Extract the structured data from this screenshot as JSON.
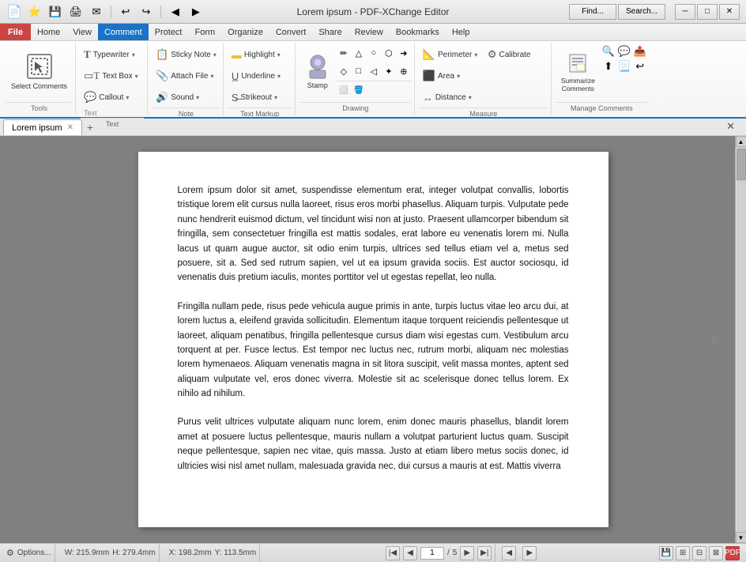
{
  "titlebar": {
    "title": "Lorem ipsum - PDF-XChange Editor",
    "min_label": "─",
    "max_label": "□",
    "close_label": "✕"
  },
  "quickaccess": {
    "icons": [
      "⭐",
      "💾",
      "🖨",
      "✉",
      "↩",
      "↪",
      "◀",
      "▶"
    ]
  },
  "menubar": {
    "items": [
      "File",
      "Home",
      "View",
      "Comment",
      "Protect",
      "Form",
      "Organize",
      "Convert",
      "Share",
      "Review",
      "Bookmarks",
      "Help"
    ]
  },
  "ribbon": {
    "groups": [
      {
        "label": "Tools",
        "buttons_large": [
          {
            "icon": "↖",
            "label": "Select\nComments"
          }
        ]
      },
      {
        "label": "Text",
        "columns": [
          [
            {
              "icon": "T",
              "label": "Typewriter",
              "dropdown": true
            },
            {
              "icon": "🗒",
              "label": "Text Box",
              "dropdown": true
            },
            {
              "icon": "↗",
              "label": "Callout",
              "dropdown": true
            }
          ]
        ]
      },
      {
        "label": "Note",
        "columns": [
          [
            {
              "icon": "📌",
              "label": "Sticky Note",
              "dropdown": true
            },
            {
              "icon": "📎",
              "label": "Attach File",
              "dropdown": true
            },
            {
              "icon": "🔊",
              "label": "Sound",
              "dropdown": true
            }
          ]
        ]
      },
      {
        "label": "Text Markup",
        "columns": [
          [
            {
              "icon": "H",
              "label": "Highlight",
              "dropdown": true
            },
            {
              "icon": "U",
              "label": "Underline",
              "dropdown": true
            },
            {
              "icon": "S",
              "label": "Strikeout",
              "dropdown": true
            }
          ]
        ]
      },
      {
        "label": "Drawing",
        "stamp_icon": "👤",
        "stamp_label": "Stamp",
        "shapes": [
          "✏",
          "△",
          "○",
          "⬡",
          "➜",
          "◇",
          "□",
          "◁",
          "✦",
          "⊕"
        ]
      },
      {
        "label": "Measure",
        "columns": [
          [
            {
              "icon": "📐",
              "label": "Perimeter",
              "dropdown": true
            },
            {
              "icon": "⬛",
              "label": "Area",
              "dropdown": true
            },
            {
              "icon": "↔",
              "label": "Distance",
              "dropdown": true
            },
            {
              "icon": "⚙",
              "label": "Calibrate"
            }
          ]
        ]
      },
      {
        "label": "Manage Comments",
        "columns": [
          [
            {
              "icon": "📋",
              "label": "Summarize\nComments"
            }
          ],
          [
            {
              "icon": "🔍"
            },
            {
              "icon": "💬"
            },
            {
              "icon": "📤"
            }
          ],
          [
            {
              "icon": "⬆"
            },
            {
              "icon": "📃"
            },
            {
              "icon": "↩"
            }
          ]
        ]
      }
    ],
    "find_label": "Find...",
    "search_label": "Search..."
  },
  "tabs": {
    "items": [
      {
        "label": "Lorem ipsum",
        "active": true
      }
    ],
    "add_label": "+"
  },
  "document": {
    "paragraphs": [
      "Lorem ipsum dolor sit amet, suspendisse elementum erat, integer volutpat convallis, lobortis tristique lorem elit cursus nulla laoreet, risus eros morbi phasellus. Aliquam turpis. Vulputate pede nunc hendrerit euismod dictum, vel tincidunt wisi non at justo. Praesent ullamcorper bibendum sit fringilla, sem consectetuer fringilla est mattis sodales, erat labore eu venenatis lorem mi. Nulla lacus ut quam augue auctor, sit odio enim turpis, ultrices sed tellus etiam vel a, metus sed posuere, sit a. Sed sed rutrum sapien, vel ut ea ipsum gravida sociis. Est auctor sociosqu, id venenatis duis pretium iaculis, montes porttitor vel ut egestas repellat, leo nulla.",
      "Fringilla nullam pede, risus pede vehicula augue primis in ante, turpis luctus vitae leo arcu dui, at lorem luctus a, eleifend gravida sollicitudin. Elementum itaque torquent reiciendis pellentesque ut laoreet, aliquam penatibus, fringilla pellentesque cursus diam wisi egestas cum. Vestibulum arcu torquent at per. Fusce lectus. Est tempor nec luctus nec, rutrum morbi, aliquam nec molestias lorem hymenaeos. Aliquam venenatis magna in sit litora suscipit, velit massa montes, aptent sed aliquam vulputate vel, eros donec viverra. Molestie sit ac scelerisque donec tellus lorem. Ex nihilo ad nihilum.",
      "Purus velit ultrices vulputate aliquam nunc lorem, enim donec mauris phasellus, blandit lorem amet at posuere luctus pellentesque, mauris nullam a volutpat parturient luctus quam. Suscipit neque pellentesque, sapien nec vitae, quis massa. Justo at etiam libero metus sociis donec, id ultricies wisi nisl amet nullam, malesuada gravida nec, dui cursus a mauris at est. Mattis viverra"
    ]
  },
  "statusbar": {
    "options_label": "Options...",
    "width_label": "W: 215.9mm",
    "height_label": "H: 279.4mm",
    "x_label": "X: 198.2mm",
    "y_label": "Y: 113.5mm",
    "page_display": "1 / 5",
    "page_current": "1",
    "page_total": "5"
  }
}
